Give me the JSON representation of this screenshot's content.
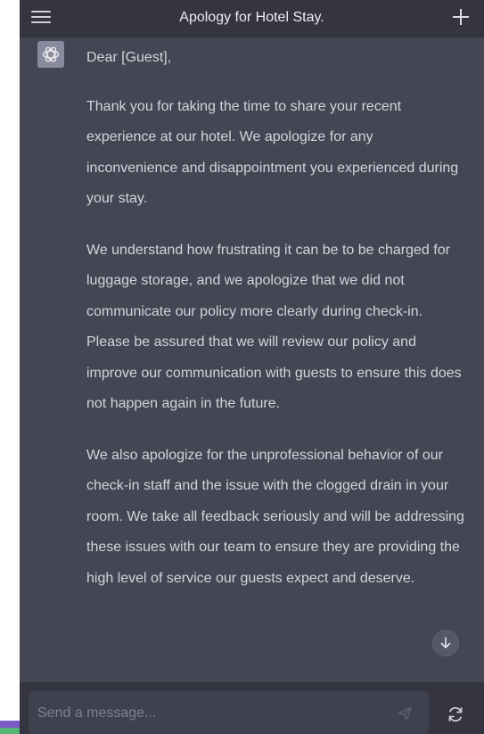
{
  "header": {
    "title": "Apology for Hotel Stay."
  },
  "message": {
    "paragraphs": [
      "Dear [Guest],",
      "Thank you for taking the time to share your recent experience at our hotel. We apologize for any inconvenience and disappointment you experienced during your stay.",
      "We understand how frustrating it can be to be charged for luggage storage, and we apologize that we did not communicate our policy more clearly during check-in. Please be assured that we will review our policy and improve our communication with guests to ensure this does not happen again in the future.",
      "We also apologize for the unprofessional behavior of our check-in staff and the issue with the clogged drain in your room. We take all feedback seriously and will be addressing these issues with our team to ensure they are providing the high level of service our guests expect and deserve."
    ]
  },
  "composer": {
    "placeholder": "Send a message..."
  },
  "icons": {
    "menu": "hamburger-menu-icon",
    "new_chat": "plus-icon",
    "avatar": "assistant-logo-icon",
    "scroll_down": "arrow-down-icon",
    "send": "paper-plane-icon",
    "regenerate": "refresh-icon"
  },
  "colors": {
    "background": "#343541",
    "message_background": "#444654",
    "text": "#d1d5db",
    "input_background": "#40414f"
  }
}
